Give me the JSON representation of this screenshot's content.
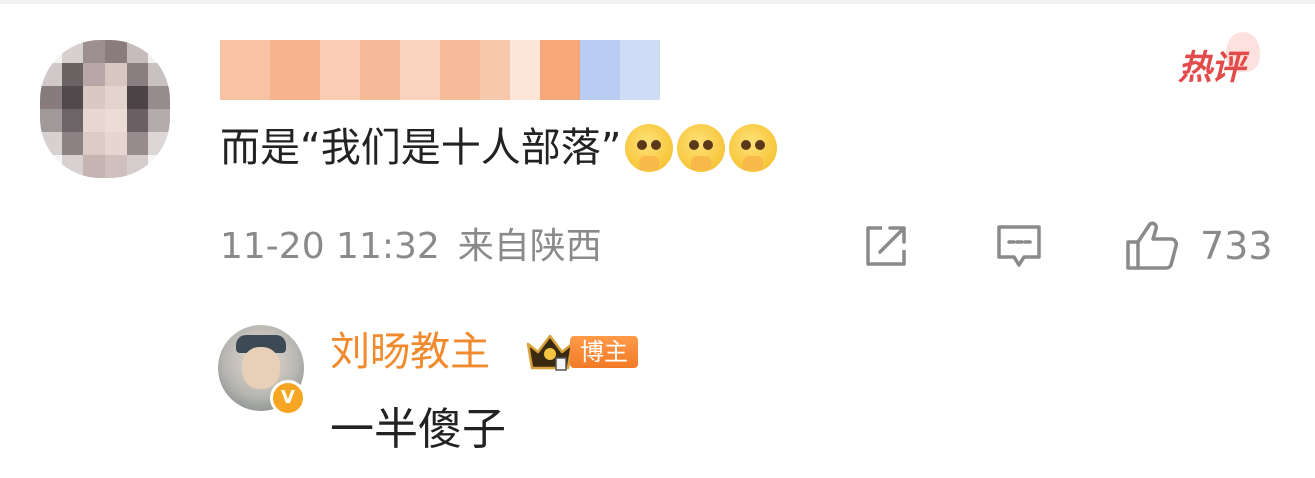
{
  "comment": {
    "hot_label": "热评",
    "text": "而是“我们是十人部落”",
    "emojis": [
      "pray-emoji",
      "pray-emoji",
      "pray-emoji"
    ],
    "time": "11-20 11:32",
    "source": "来自陕西",
    "like_count": "733"
  },
  "reply": {
    "author": "刘旸教主",
    "badge": "博主",
    "text": "一半傻子"
  },
  "icons": {
    "share": "share-icon",
    "comment": "comment-icon",
    "like": "thumbs-up-icon"
  },
  "colors": {
    "hot": "#e34a4a",
    "reply_name": "#f08a2c",
    "badge": "#f27a26",
    "meta": "#8a8a8a",
    "text": "#222222"
  }
}
